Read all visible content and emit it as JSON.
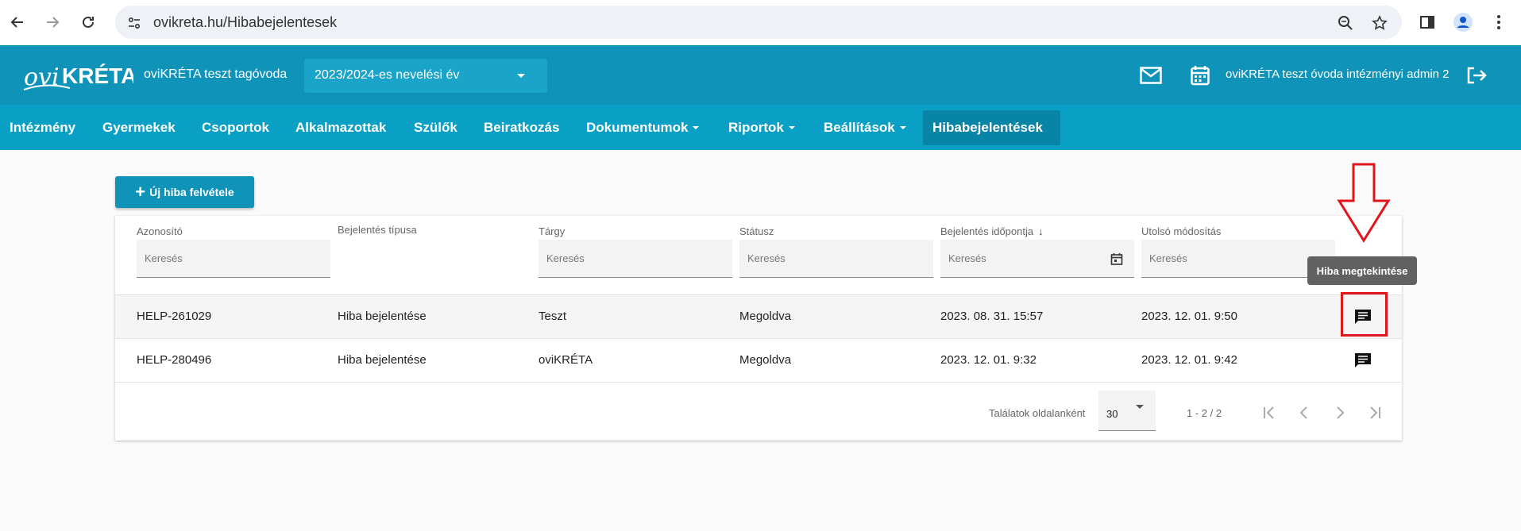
{
  "browser": {
    "url": "ovikreta.hu/Hibabejelentesek"
  },
  "header": {
    "logo_text": "oviKRÉTA",
    "institution": "oviKRÉTA teszt tagóvoda",
    "year_select": "2023/2024-es nevelési év",
    "user_name": "oviKRÉTA teszt óvoda intézményi admin 2"
  },
  "nav": {
    "items": [
      {
        "label": "Intézmény",
        "has_dropdown": false,
        "active": false
      },
      {
        "label": "Gyermekek",
        "has_dropdown": false,
        "active": false
      },
      {
        "label": "Csoportok",
        "has_dropdown": false,
        "active": false
      },
      {
        "label": "Alkalmazottak",
        "has_dropdown": false,
        "active": false
      },
      {
        "label": "Szülők",
        "has_dropdown": false,
        "active": false
      },
      {
        "label": "Beiratkozás",
        "has_dropdown": false,
        "active": false
      },
      {
        "label": "Dokumentumok",
        "has_dropdown": true,
        "active": false
      },
      {
        "label": "Riportok",
        "has_dropdown": true,
        "active": false
      },
      {
        "label": "Beállítások",
        "has_dropdown": true,
        "active": false
      },
      {
        "label": "Hibabejelentések",
        "has_dropdown": false,
        "active": true
      }
    ]
  },
  "toolbar": {
    "add_label": "Új hiba felvétele"
  },
  "grid": {
    "columns": [
      {
        "label": "Azonosító",
        "filter_placeholder": "Keresés"
      },
      {
        "label": "Bejelentés típusa",
        "filter_placeholder": ""
      },
      {
        "label": "Tárgy",
        "filter_placeholder": "Keresés"
      },
      {
        "label": "Státusz",
        "filter_placeholder": "Keresés"
      },
      {
        "label": "Bejelentés időpontja",
        "filter_placeholder": "Keresés",
        "sorted": "desc"
      },
      {
        "label": "Utolsó módosítás",
        "filter_placeholder": "Keresés"
      }
    ],
    "rows": [
      [
        "HELP-261029",
        "Hiba bejelentése",
        "Teszt",
        "Megoldva",
        "2023. 08. 31. 15:57",
        "2023. 12. 01. 9:50"
      ],
      [
        "HELP-280496",
        "Hiba bejelentése",
        "oviKRÉTA",
        "Megoldva",
        "2023. 12. 01. 9:32",
        "2023. 12. 01. 9:42"
      ]
    ],
    "footer": {
      "per_page_label": "Találatok oldalanként",
      "per_page_value": "30",
      "range": "1 - 2 / 2"
    }
  },
  "tooltip": "Hiba megtekintése",
  "colors": {
    "header": "#0f93b9",
    "nav": "#0aa0c6",
    "nav_active": "#0884a7",
    "annotation": "#e0161c"
  }
}
